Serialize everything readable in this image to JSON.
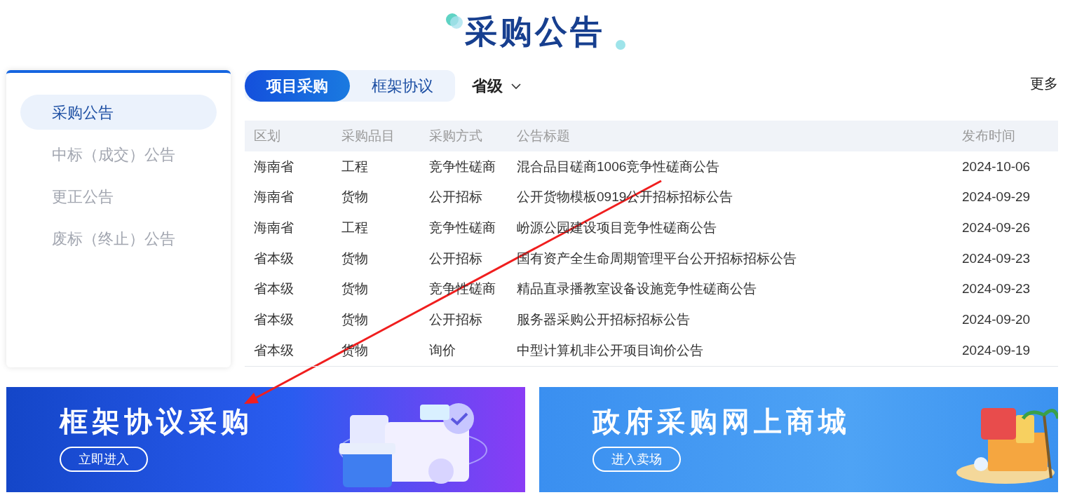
{
  "title": "采购公告",
  "sidebar": {
    "items": [
      {
        "label": "采购公告",
        "selected": true
      },
      {
        "label": "中标（成交）公告",
        "selected": false
      },
      {
        "label": "更正公告",
        "selected": false
      },
      {
        "label": "废标（终止）公告",
        "selected": false
      }
    ]
  },
  "tabs": [
    {
      "label": "项目采购",
      "selected": true
    },
    {
      "label": "框架协议",
      "selected": false
    }
  ],
  "filter": {
    "label": "省级"
  },
  "more_link": "更多",
  "table": {
    "columns": [
      "区划",
      "采购品目",
      "采购方式",
      "公告标题",
      "发布时间"
    ],
    "rows": [
      [
        "海南省",
        "工程",
        "竞争性磋商",
        "混合品目磋商1006竞争性磋商公告",
        "2024-10-06"
      ],
      [
        "海南省",
        "货物",
        "公开招标",
        "公开货物模板0919公开招标招标公告",
        "2024-09-29"
      ],
      [
        "海南省",
        "工程",
        "竞争性磋商",
        "岎源公园建设项目竞争性磋商公告",
        "2024-09-26"
      ],
      [
        "省本级",
        "货物",
        "公开招标",
        "国有资产全生命周期管理平台公开招标招标公告",
        "2024-09-23"
      ],
      [
        "省本级",
        "货物",
        "竞争性磋商",
        "精品直录播教室设备设施竞争性磋商公告",
        "2024-09-23"
      ],
      [
        "省本级",
        "货物",
        "公开招标",
        "服务器采购公开招标招标公告",
        "2024-09-20"
      ],
      [
        "省本级",
        "货物",
        "询价",
        "中型计算机非公开项目询价公告",
        "2024-09-19"
      ]
    ]
  },
  "banners": [
    {
      "kind": "framework",
      "title": "框架协议采购",
      "button": "立即进入"
    },
    {
      "kind": "mall",
      "title": "政府采购网上商城",
      "button": "进入卖场"
    }
  ]
}
